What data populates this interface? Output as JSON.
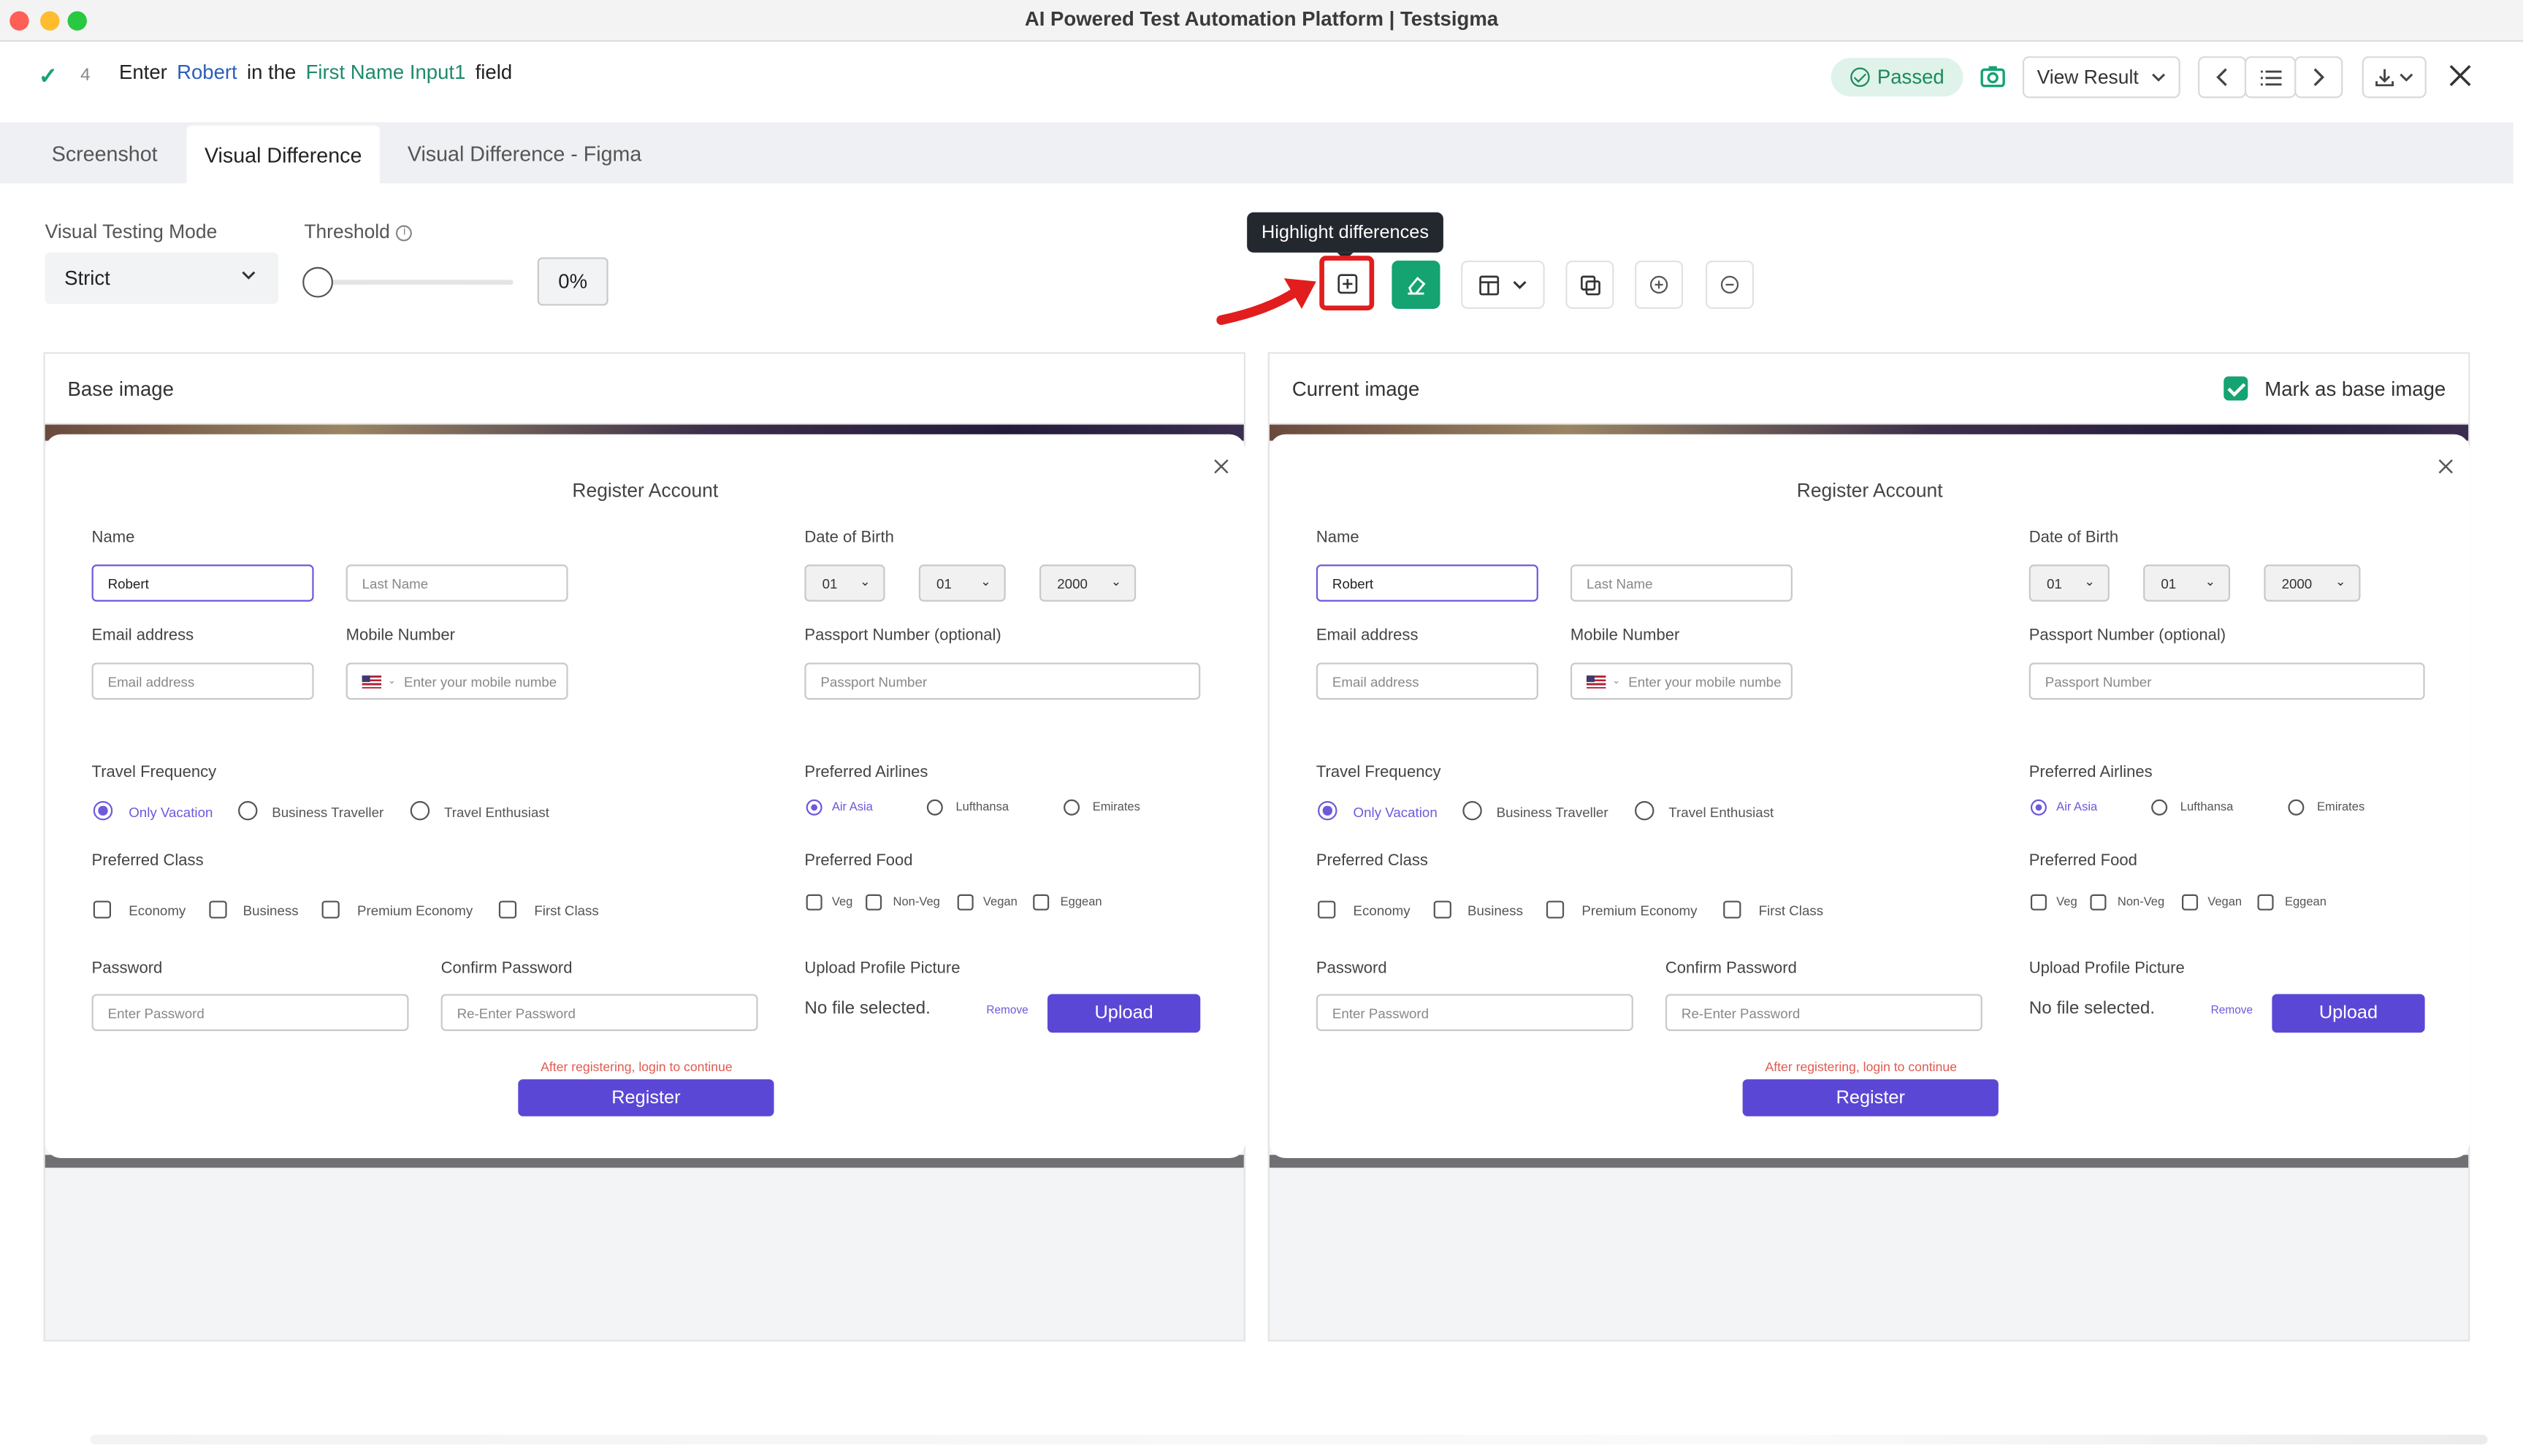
{
  "window": {
    "title": "AI Powered Test Automation Platform | Testsigma"
  },
  "step": {
    "number": "4",
    "tokens": [
      "Enter",
      "Robert",
      "in the",
      "First Name Input1",
      "field"
    ],
    "status": "Passed",
    "view_result_label": "View Result"
  },
  "tabs": [
    {
      "label": "Screenshot"
    },
    {
      "label": "Visual Difference"
    },
    {
      "label": "Visual Difference - Figma"
    }
  ],
  "controls": {
    "mode_label": "Visual Testing Mode",
    "mode_value": "Strict",
    "threshold_label": "Threshold",
    "threshold_value": "0%"
  },
  "toolbar": {
    "tooltip": "Highlight differences",
    "colors": {
      "green": "#14a371",
      "highlight_border": "#e11d1d"
    }
  },
  "panels": {
    "base": {
      "title": "Base image"
    },
    "current": {
      "title": "Current image",
      "mark_base_label": "Mark as base image"
    }
  },
  "form": {
    "title": "Register Account",
    "name_label": "Name",
    "first_name_value": "Robert",
    "last_name_placeholder": "Last Name",
    "dob_label": "Date of Birth",
    "dob_day": "01",
    "dob_month": "01",
    "dob_year": "2000",
    "email_label": "Email address",
    "email_placeholder": "Email address",
    "mobile_label": "Mobile Number",
    "mobile_placeholder": "Enter your mobile numbe",
    "passport_label": "Passport Number (optional)",
    "passport_placeholder": "Passport Number",
    "travel_label": "Travel Frequency",
    "travel_options": [
      "Only Vacation",
      "Business Traveller",
      "Travel Enthusiast"
    ],
    "airlines_label": "Preferred Airlines",
    "airlines_options": [
      "Air Asia",
      "Lufthansa",
      "Emirates"
    ],
    "class_label": "Preferred Class",
    "class_options": [
      "Economy",
      "Business",
      "Premium Economy",
      "First Class"
    ],
    "food_label": "Preferred Food",
    "food_options": [
      "Veg",
      "Non-Veg",
      "Vegan",
      "Eggean"
    ],
    "password_label": "Password",
    "password_placeholder": "Enter Password",
    "confirm_label": "Confirm Password",
    "confirm_placeholder": "Re-Enter Password",
    "upload_label": "Upload Profile Picture",
    "no_file": "No file selected.",
    "remove_label": "Remove",
    "upload_button": "Upload",
    "warning": "After registering, login to continue",
    "register_button": "Register"
  },
  "icons": [
    "check-icon",
    "passed-check-icon",
    "camera-icon",
    "chevron-down-icon",
    "chevron-left-icon",
    "list-icon",
    "chevron-right-icon",
    "download-icon",
    "close-icon",
    "info-icon",
    "highlight-differences-icon",
    "eraser-icon",
    "layout-icon",
    "copy-icon",
    "zoom-in-icon",
    "zoom-out-icon"
  ]
}
